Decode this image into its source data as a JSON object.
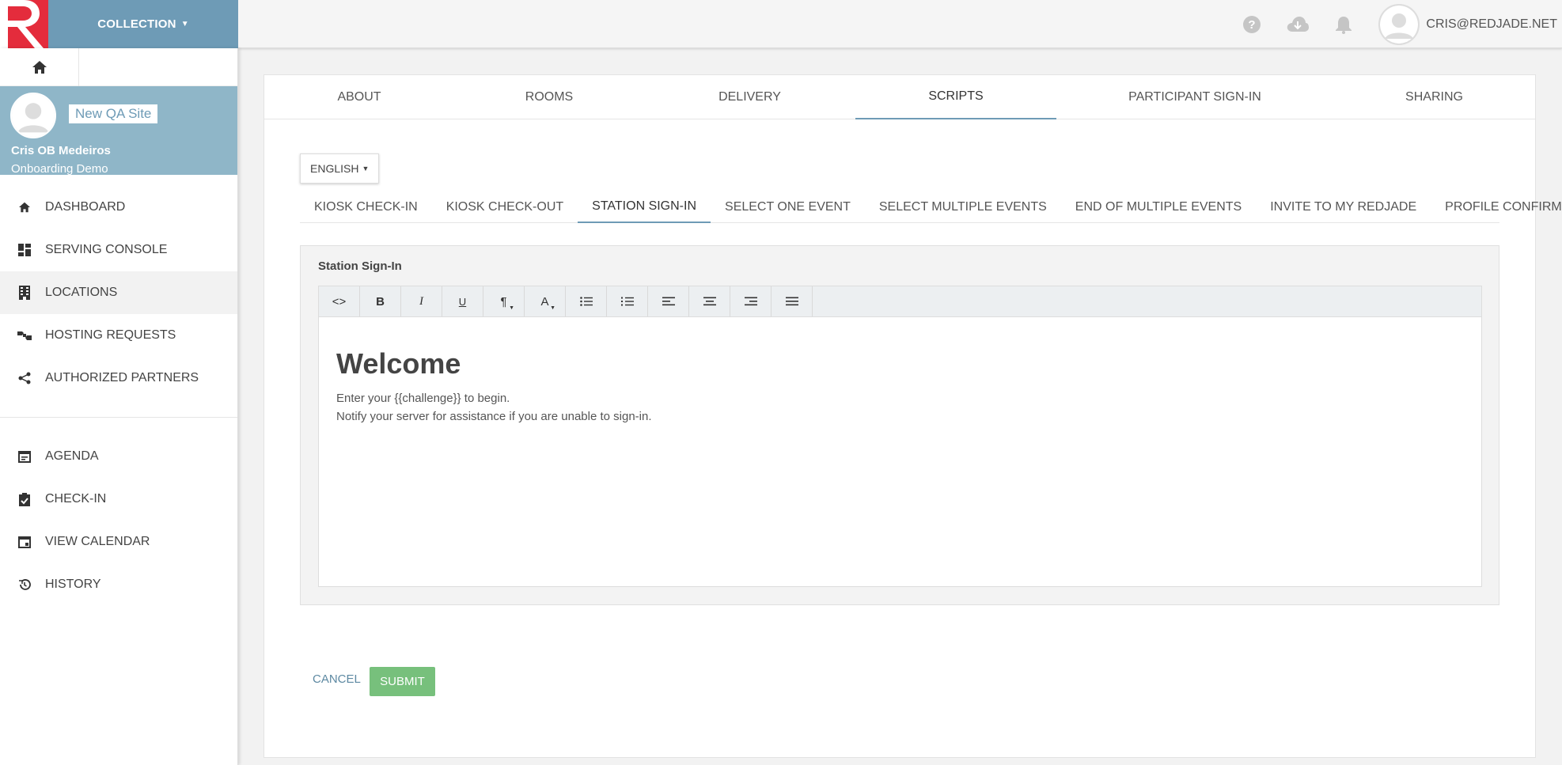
{
  "header": {
    "collection_label": "COLLECTION",
    "user_email": "CRIS@REDJADE.NET",
    "icons": [
      "help-icon",
      "cloud-download-icon",
      "bell-icon",
      "avatar-icon"
    ]
  },
  "profile": {
    "site_name": "New QA Site",
    "user_name": "Cris OB Medeiros",
    "company": "Onboarding Demo"
  },
  "sidebar": {
    "items": [
      {
        "label": "DASHBOARD",
        "icon": "home-icon"
      },
      {
        "label": "SERVING CONSOLE",
        "icon": "dashboard-icon"
      },
      {
        "label": "LOCATIONS",
        "icon": "building-icon"
      },
      {
        "label": "HOSTING REQUESTS",
        "icon": "handshake-icon"
      },
      {
        "label": "AUTHORIZED PARTNERS",
        "icon": "share-icon"
      }
    ],
    "items2": [
      {
        "label": "AGENDA",
        "icon": "agenda-icon"
      },
      {
        "label": "CHECK-IN",
        "icon": "clipboard-check-icon"
      },
      {
        "label": "VIEW CALENDAR",
        "icon": "calendar-icon"
      },
      {
        "label": "HISTORY",
        "icon": "history-icon"
      }
    ]
  },
  "tabs": [
    {
      "label": "ABOUT"
    },
    {
      "label": "ROOMS"
    },
    {
      "label": "DELIVERY"
    },
    {
      "label": "SCRIPTS"
    },
    {
      "label": "PARTICIPANT SIGN-IN"
    },
    {
      "label": "SHARING"
    }
  ],
  "language": "ENGLISH",
  "subtabs": [
    {
      "label": "KIOSK CHECK-IN"
    },
    {
      "label": "KIOSK CHECK-OUT"
    },
    {
      "label": "STATION SIGN-IN"
    },
    {
      "label": "SELECT ONE EVENT"
    },
    {
      "label": "SELECT MULTIPLE EVENTS"
    },
    {
      "label": "END OF MULTIPLE EVENTS"
    },
    {
      "label": "INVITE TO MY REDJADE"
    },
    {
      "label": "PROFILE CONFIRM"
    }
  ],
  "editor": {
    "label": "Station Sign-In",
    "heading": "Welcome",
    "line1": "Enter your {{challenge}} to begin.",
    "line2": "Notify your server for assistance if you are unable to sign-in."
  },
  "actions": {
    "cancel": "CANCEL",
    "submit": "SUBMIT"
  },
  "colors": {
    "brand_red": "#e42c3c",
    "accent_blue": "#6e9bb6",
    "submit_green": "#77c07c"
  }
}
